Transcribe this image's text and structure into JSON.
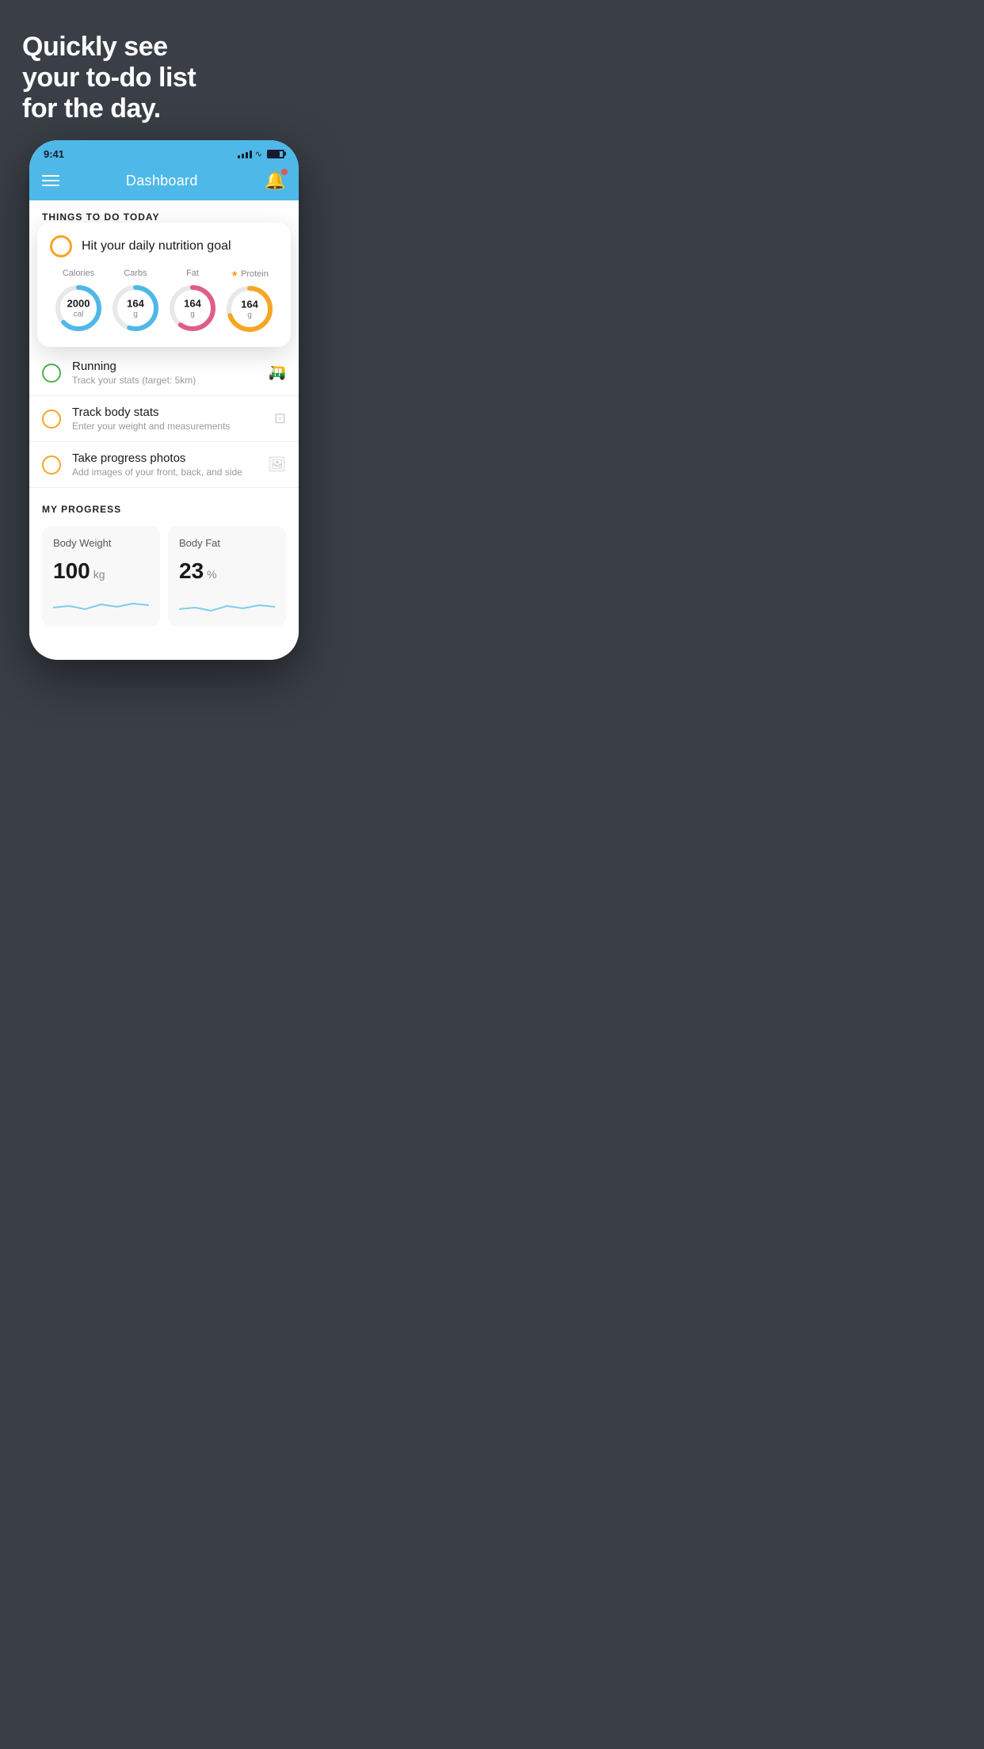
{
  "hero": {
    "title": "Quickly see\nyour to-do list\nfor the day."
  },
  "phone": {
    "status_bar": {
      "time": "9:41"
    },
    "header": {
      "title": "Dashboard"
    },
    "section_label": "THINGS TO DO TODAY",
    "floating_card": {
      "circle_color": "#f5a623",
      "title": "Hit your daily nutrition goal",
      "nutrition": [
        {
          "label": "Calories",
          "value": "2000",
          "unit": "cal",
          "color": "#4eb8e8",
          "percent": 65
        },
        {
          "label": "Carbs",
          "value": "164",
          "unit": "g",
          "color": "#4eb8e8",
          "percent": 55
        },
        {
          "label": "Fat",
          "value": "164",
          "unit": "g",
          "color": "#e05d8a",
          "percent": 60
        },
        {
          "label": "Protein",
          "value": "164",
          "unit": "g",
          "color": "#f5a623",
          "percent": 70,
          "starred": true
        }
      ]
    },
    "todo_items": [
      {
        "id": "running",
        "title": "Running",
        "subtitle": "Track your stats (target: 5km)",
        "circle_color": "green",
        "icon": "👟"
      },
      {
        "id": "body-stats",
        "title": "Track body stats",
        "subtitle": "Enter your weight and measurements",
        "circle_color": "yellow",
        "icon": "⚖️"
      },
      {
        "id": "photos",
        "title": "Take progress photos",
        "subtitle": "Add images of your front, back, and side",
        "circle_color": "yellow",
        "icon": "🖼️"
      }
    ],
    "progress": {
      "header": "MY PROGRESS",
      "cards": [
        {
          "title": "Body Weight",
          "value": "100",
          "unit": "kg"
        },
        {
          "title": "Body Fat",
          "value": "23",
          "unit": "%"
        }
      ]
    }
  }
}
